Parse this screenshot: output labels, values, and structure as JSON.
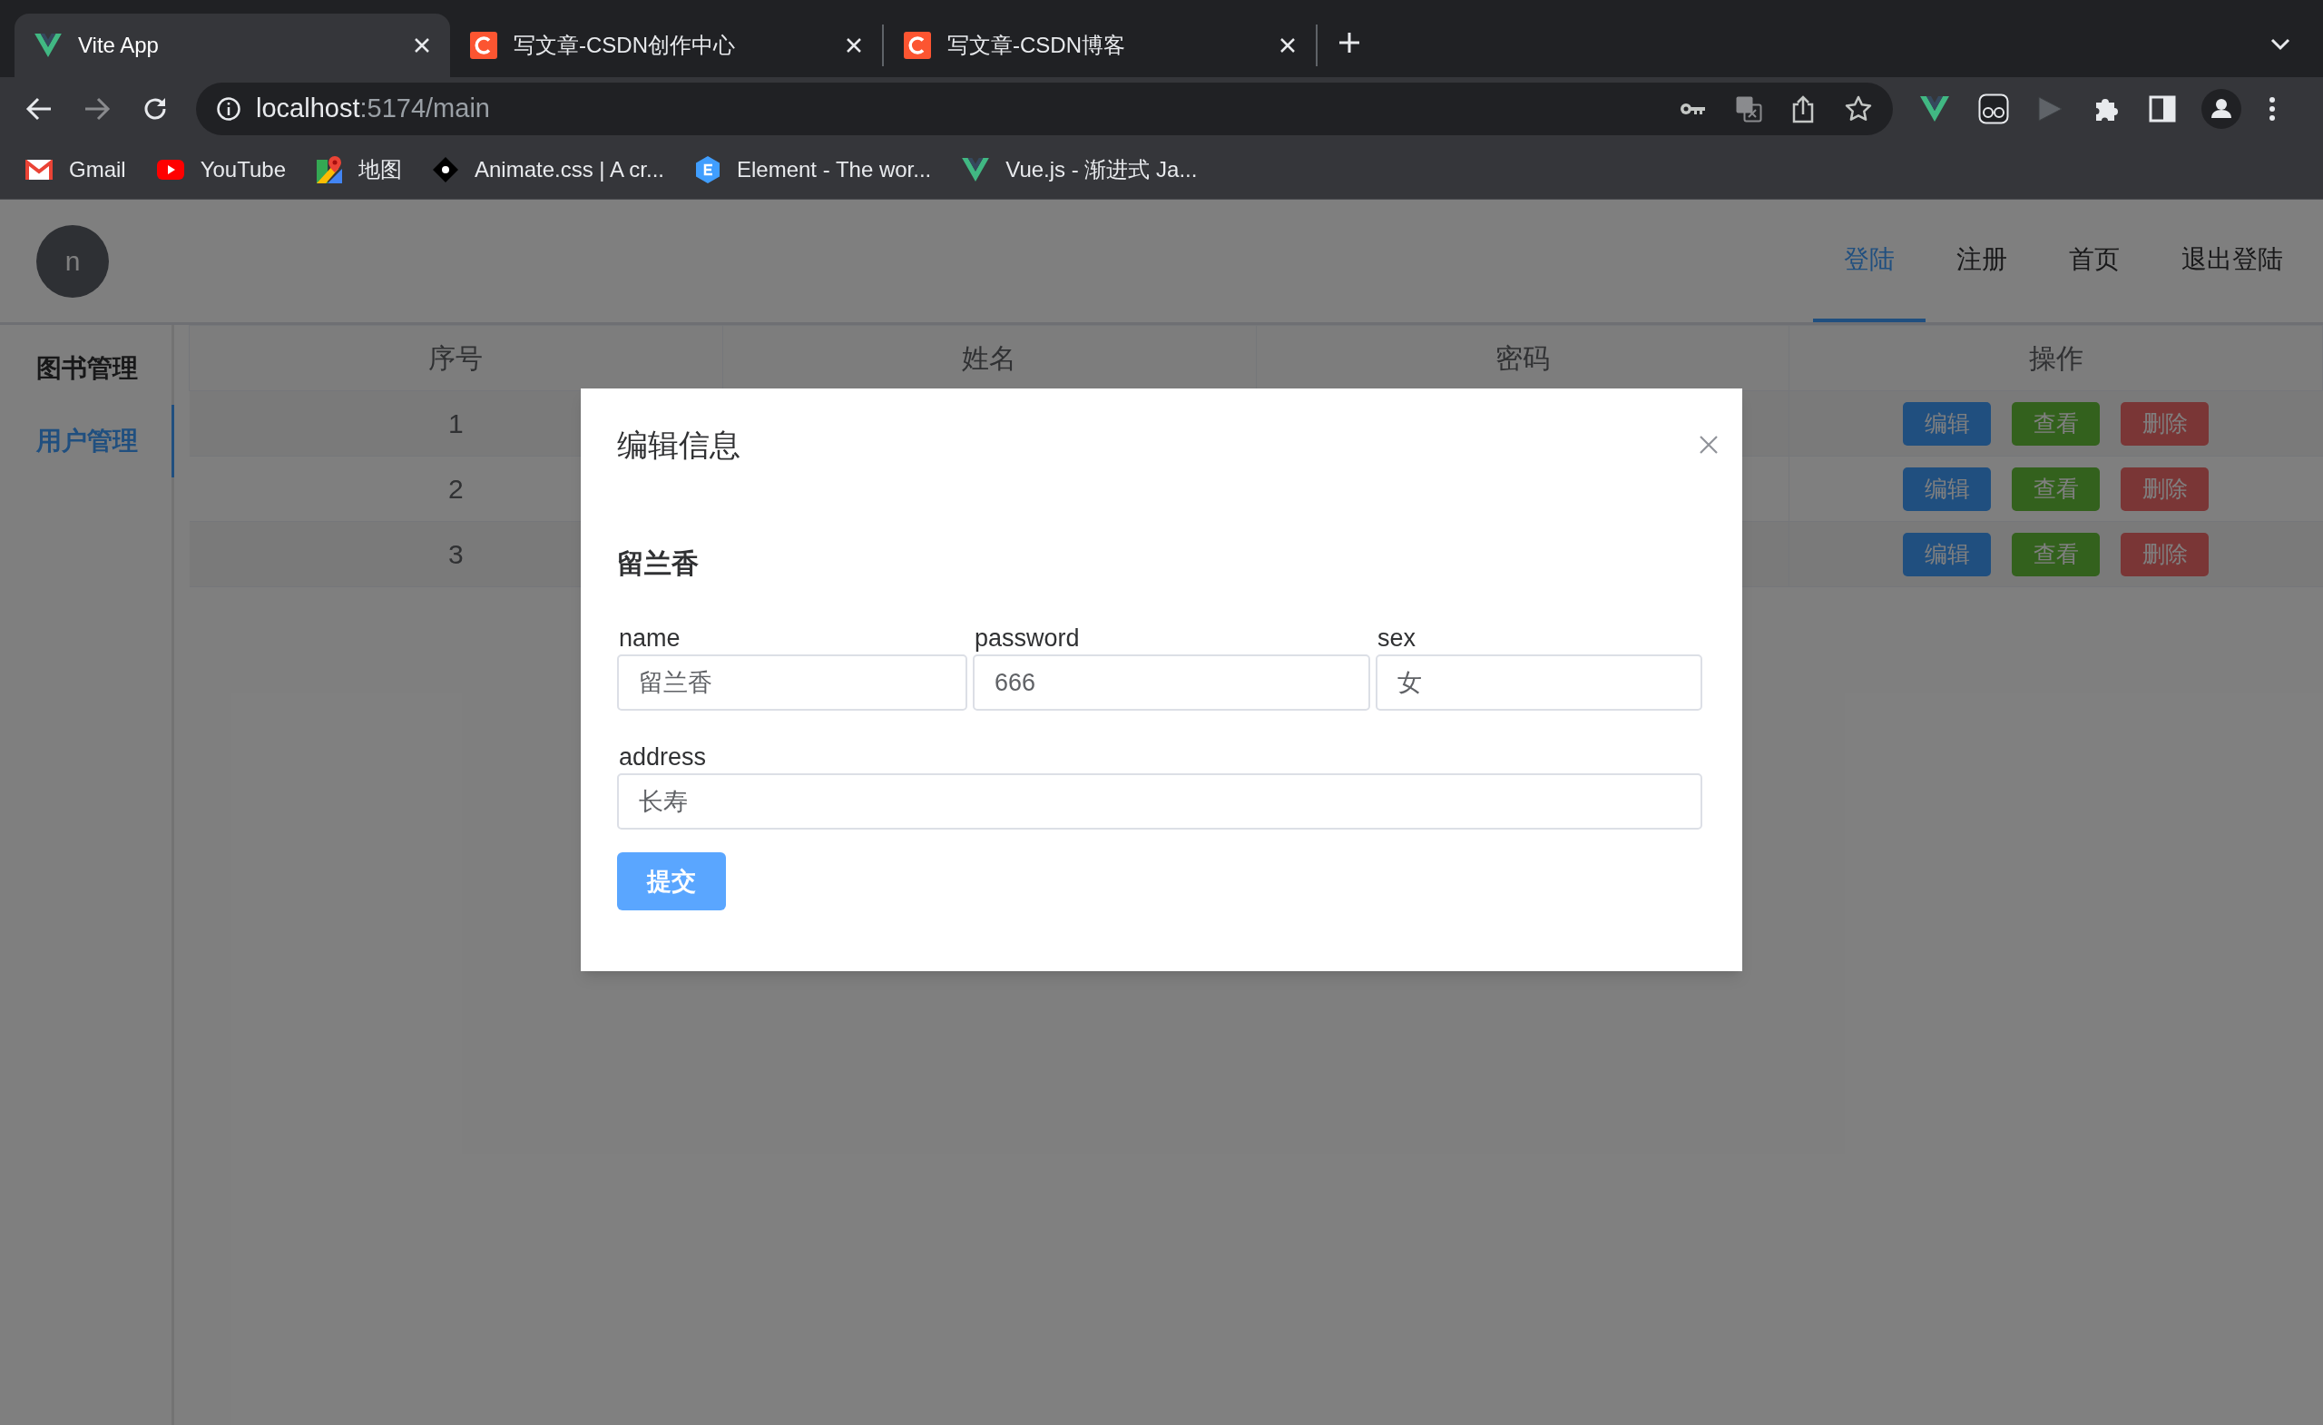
{
  "browser": {
    "tabs": [
      {
        "title": "Vite App",
        "kind": "vue",
        "selected": true
      },
      {
        "title": "写文章-CSDN创作中心",
        "kind": "csdn",
        "selected": false
      },
      {
        "title": "写文章-CSDN博客",
        "kind": "csdn",
        "selected": false
      }
    ],
    "address": {
      "host": "localhost",
      "path": ":5174/main"
    },
    "bookmarks": [
      {
        "label": "Gmail",
        "kind": "mail"
      },
      {
        "label": "YouTube",
        "kind": "video"
      },
      {
        "label": "地图",
        "kind": "map"
      },
      {
        "label": "Animate.css | A cr...",
        "kind": "diamond"
      },
      {
        "label": "Element - The wor...",
        "kind": "hexagon"
      },
      {
        "label": "Vue.js - 渐进式 Ja...",
        "kind": "vue"
      }
    ]
  },
  "app": {
    "avatar": "n",
    "nav": [
      {
        "label": "登陆",
        "selected": true
      },
      {
        "label": "注册",
        "selected": false
      },
      {
        "label": "首页",
        "selected": false
      },
      {
        "label": "退出登陆",
        "selected": false
      }
    ],
    "sidebar": [
      {
        "label": "图书管理",
        "selected": false
      },
      {
        "label": "用户管理",
        "selected": true
      }
    ],
    "table": {
      "columns": [
        "序号",
        "姓名",
        "密码",
        "操作"
      ],
      "rows": [
        {
          "index": "1",
          "actions": [
            {
              "label": "编辑",
              "kind": "primary"
            },
            {
              "label": "查看",
              "kind": "success"
            },
            {
              "label": "删除",
              "kind": "danger"
            }
          ]
        },
        {
          "index": "2",
          "actions": [
            {
              "label": "编辑",
              "kind": "primary"
            },
            {
              "label": "查看",
              "kind": "success"
            },
            {
              "label": "删除",
              "kind": "danger"
            }
          ]
        },
        {
          "index": "3",
          "actions": [
            {
              "label": "编辑",
              "kind": "primary"
            },
            {
              "label": "查看",
              "kind": "success"
            },
            {
              "label": "删除",
              "kind": "danger"
            }
          ]
        }
      ]
    }
  },
  "dialog": {
    "title": "编辑信息",
    "heading": "留兰香",
    "fields": [
      {
        "label": "name",
        "value": "留兰香"
      },
      {
        "label": "password",
        "value": "666"
      },
      {
        "label": "sex",
        "value": "女"
      },
      {
        "label": "address",
        "value": "长寿"
      }
    ],
    "submit": "提交"
  }
}
